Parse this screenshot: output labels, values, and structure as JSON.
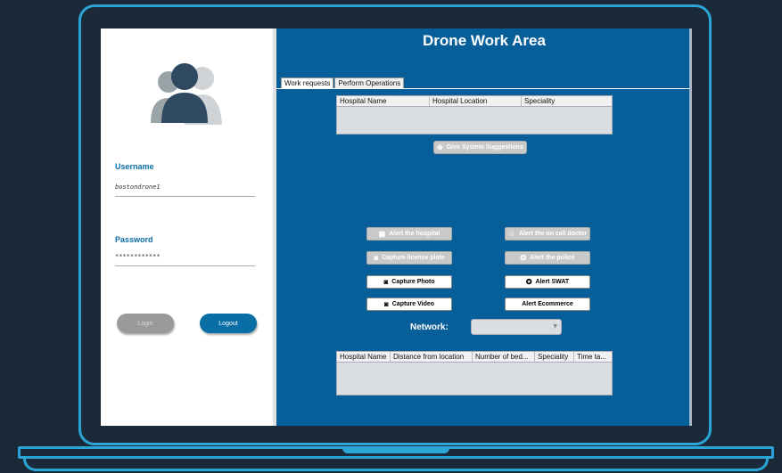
{
  "login": {
    "username_label": "Username",
    "username_value": "bostondrone1",
    "password_label": "Password",
    "password_value": "************",
    "login_button": "Login",
    "logout_button": "Logout"
  },
  "workarea": {
    "title": "Drone Work Area",
    "tabs": [
      "Work requests",
      "Perform Operations"
    ],
    "top_table_headers": [
      "Hospital Name",
      "Hospital Location",
      "Speciality"
    ],
    "suggest_button": "Give System Suggestions",
    "actions": {
      "alert_hospital": "Alert the hospital",
      "alert_doctor": "Alert the on call doctor",
      "capture_plate": "Capture license plate",
      "alert_police": "Alert the police",
      "capture_photo": "Capture Photo",
      "alert_swat": "Alert SWAT",
      "capture_video": "Capture Video",
      "alert_ecommerce": "Alert Ecommerce"
    },
    "network_label": "Network:",
    "bottom_table_headers": [
      "Hospital Name",
      "Distance from location",
      "Number of bed...",
      "Speciality",
      "Time ta..."
    ]
  },
  "colors": {
    "panel": "#065f99",
    "frame": "#2aa5d6",
    "background": "#1b2a38"
  }
}
